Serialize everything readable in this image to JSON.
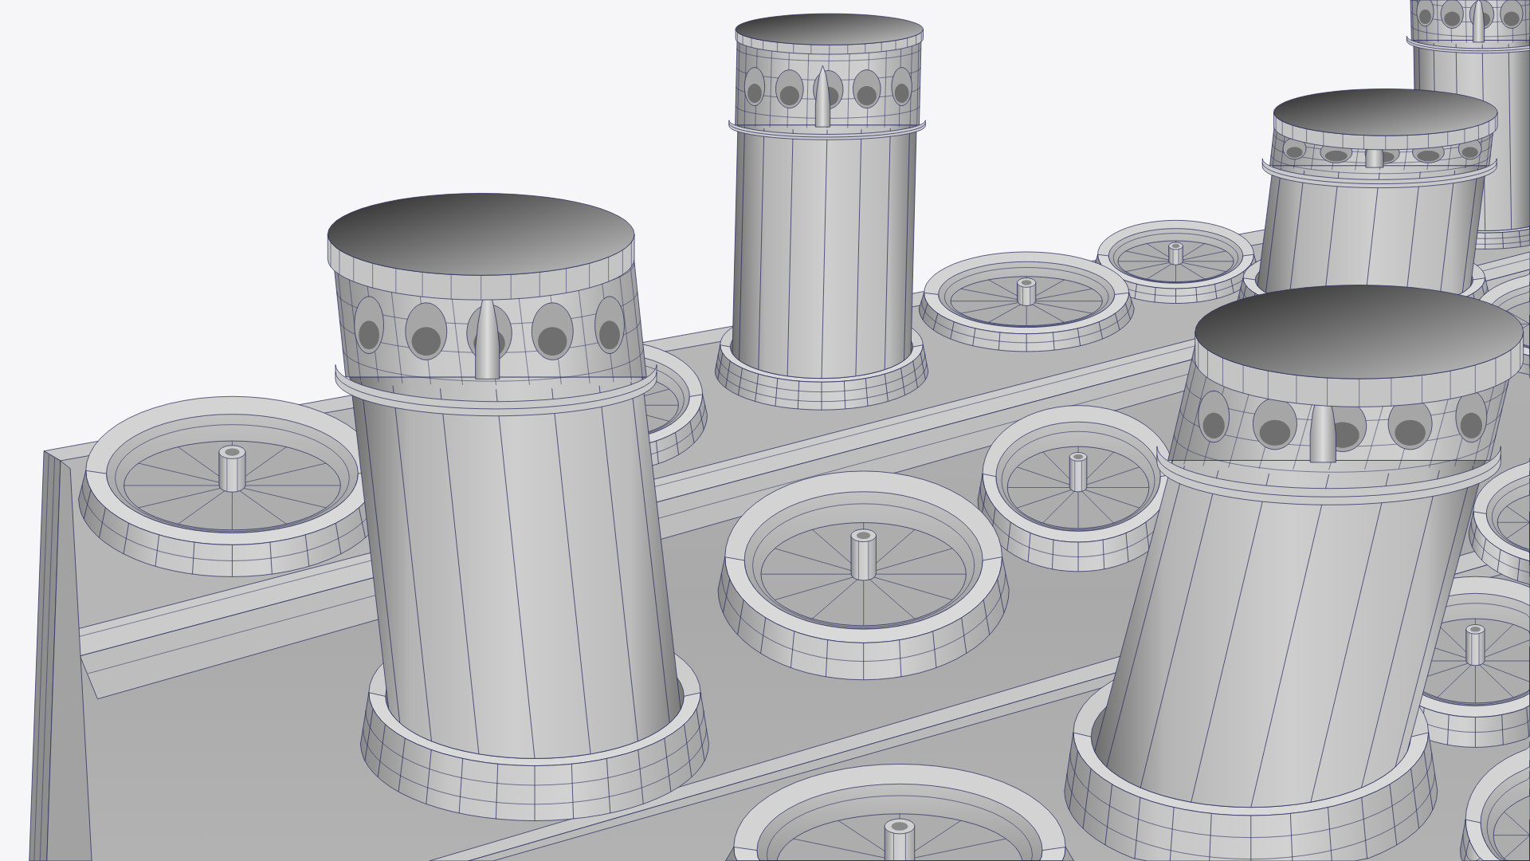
{
  "viewport": {
    "objects": [
      {
        "kind": "canister"
      },
      {
        "kind": "socket"
      },
      {
        "kind": "canister"
      },
      {
        "kind": "socket"
      },
      {
        "kind": "canister"
      },
      {
        "kind": "socket"
      },
      {
        "kind": "socket"
      },
      {
        "kind": "socket"
      },
      {
        "kind": "canister"
      },
      {
        "kind": "socket"
      },
      {
        "kind": "socket"
      },
      {
        "kind": "socket"
      },
      {
        "kind": "socket"
      },
      {
        "kind": "canister"
      },
      {
        "kind": "socket"
      },
      {
        "kind": "socket"
      }
    ]
  }
}
